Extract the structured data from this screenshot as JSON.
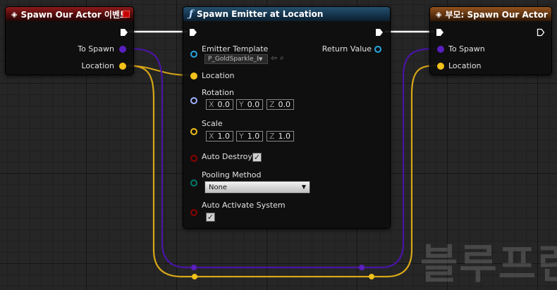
{
  "nodes": {
    "event": {
      "title": "Spawn Our Actor 이벤트",
      "pins": {
        "to_spawn": "To Spawn",
        "location": "Location"
      }
    },
    "spawn_emitter": {
      "title": "Spawn Emitter at Location",
      "inputs": {
        "emitter_template": "Emitter Template",
        "emitter_value": "P_GoldSparkle_Ba",
        "location": "Location",
        "rotation": "Rotation",
        "rotation_x": "0.0",
        "rotation_y": "0.0",
        "rotation_z": "0.0",
        "scale": "Scale",
        "scale_x": "1.0",
        "scale_y": "1.0",
        "scale_z": "1.0",
        "auto_destroy": "Auto Destroy",
        "pooling_method": "Pooling Method",
        "pooling_value": "None",
        "auto_activate": "Auto Activate System"
      },
      "outputs": {
        "return_value": "Return Value"
      }
    },
    "parent": {
      "title": "부모: Spawn Our Actor",
      "pins": {
        "to_spawn": "To Spawn",
        "location": "Location"
      }
    }
  },
  "axes": {
    "x": "X",
    "y": "Y",
    "z": "Z"
  },
  "watermark": "블루프린트",
  "colors": {
    "exec": "#ffffff",
    "object_pin": "#5a1fbf",
    "vector_pin": "#f2c11a",
    "rotator_pin": "#9fb2ff",
    "bool_pin": "#8c0000",
    "enum_pin": "#007a6e",
    "component_pin": "#26a8e0",
    "wire_object": "#4a14a6",
    "wire_vector": "#d6a616"
  }
}
